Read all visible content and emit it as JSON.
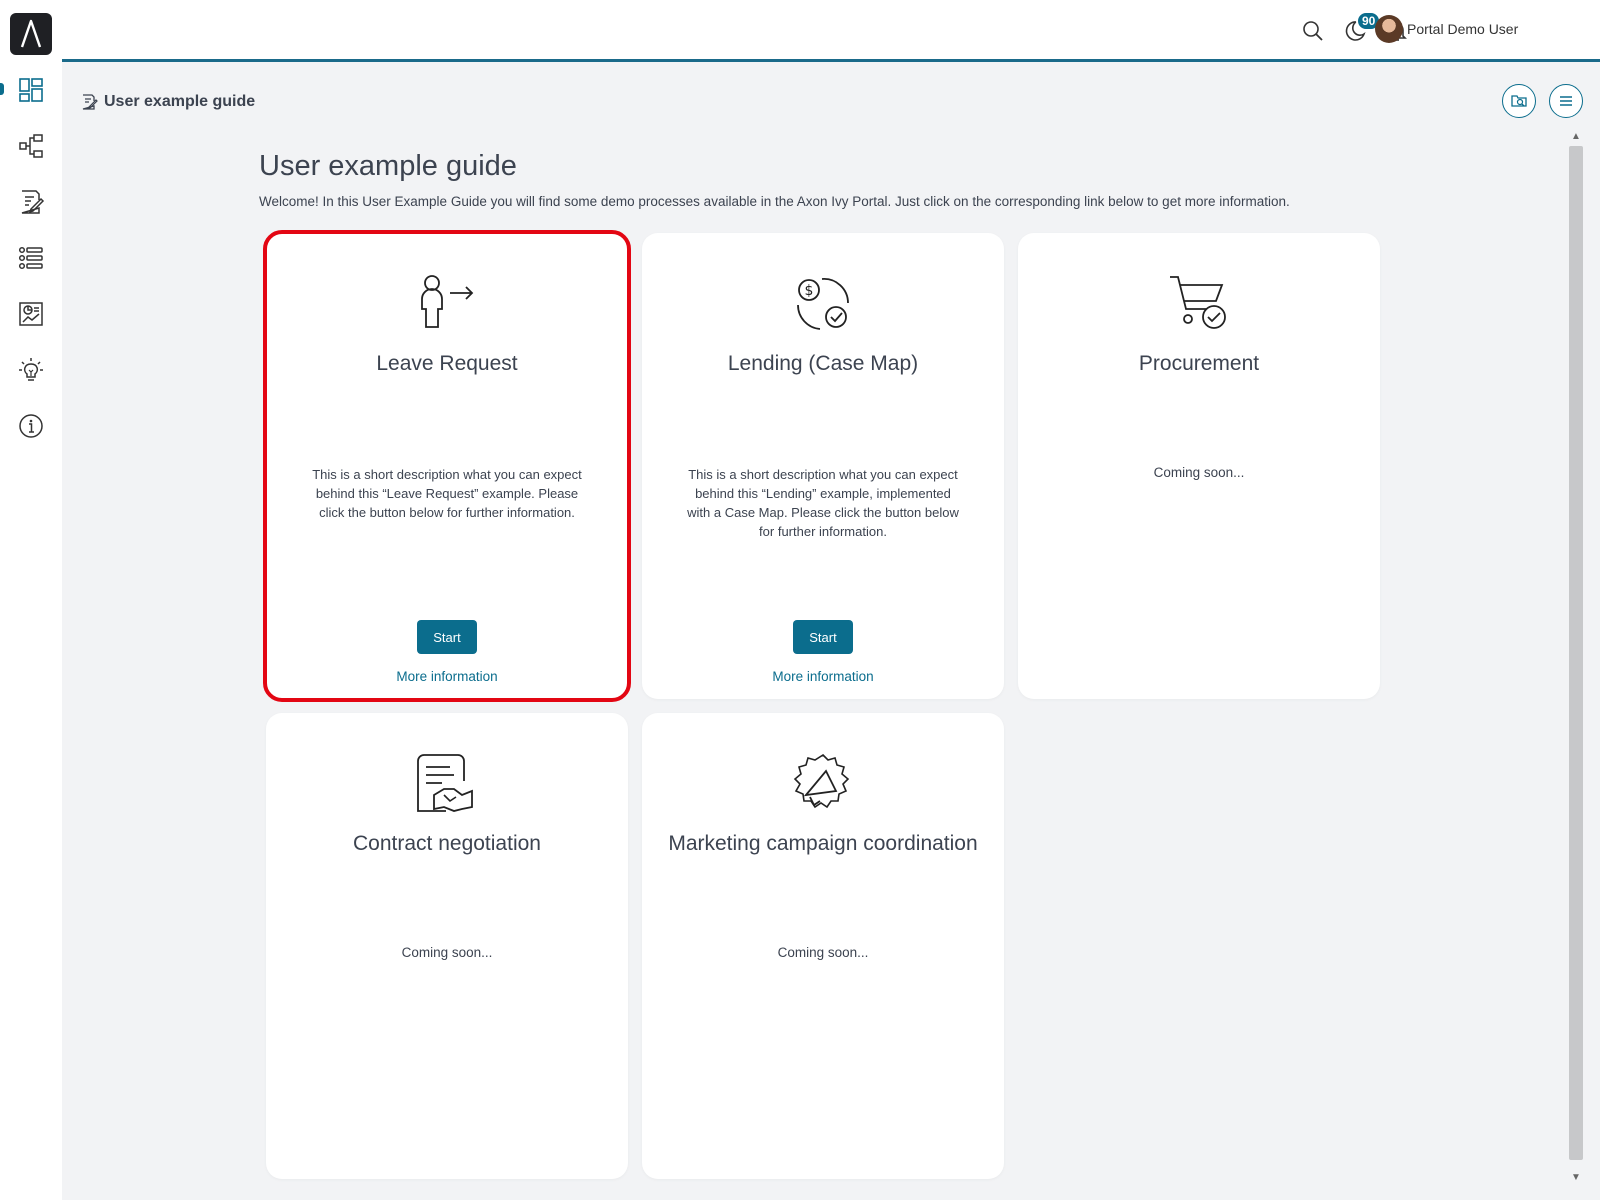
{
  "header": {
    "notification_count": "90",
    "user_name": "Portal Demo User"
  },
  "sidebar": {
    "items": [
      {
        "icon": "dashboard-icon",
        "active": true
      },
      {
        "icon": "processes-icon"
      },
      {
        "icon": "tasks-icon"
      },
      {
        "icon": "cases-icon"
      },
      {
        "icon": "statistics-icon"
      },
      {
        "icon": "ideas-icon"
      },
      {
        "icon": "info-icon"
      }
    ]
  },
  "page": {
    "breadcrumb_title": "User example guide",
    "title": "User example guide",
    "description": "Welcome! In this User Example Guide you will find some demo processes available in the Axon Ivy Portal. Just click on the corresponding link below to get more information."
  },
  "cards": [
    {
      "title": "Leave Request",
      "icon": "person-leave-icon",
      "description": "This is a short description what you can expect behind this “Leave Request” example. Please click the button below for further information.",
      "start_label": "Start",
      "more_label": "More information"
    },
    {
      "title": "Lending (Case Map)",
      "icon": "lending-money-icon",
      "description": "This is a short description what you can expect behind this “Lending” example, implemented with a Case Map. Please click the button below for further information.",
      "start_label": "Start",
      "more_label": "More information"
    },
    {
      "title": "Procurement",
      "icon": "shopping-cart-icon",
      "status": "Coming soon..."
    },
    {
      "title": "Contract negotiation",
      "icon": "contract-handshake-icon",
      "status": "Coming soon..."
    },
    {
      "title": "Marketing campaign coordination",
      "icon": "megaphone-icon",
      "status": "Coming soon..."
    }
  ],
  "colors": {
    "accent": "#0b6d8d",
    "highlight": "#e30613",
    "background": "#f2f3f5"
  }
}
